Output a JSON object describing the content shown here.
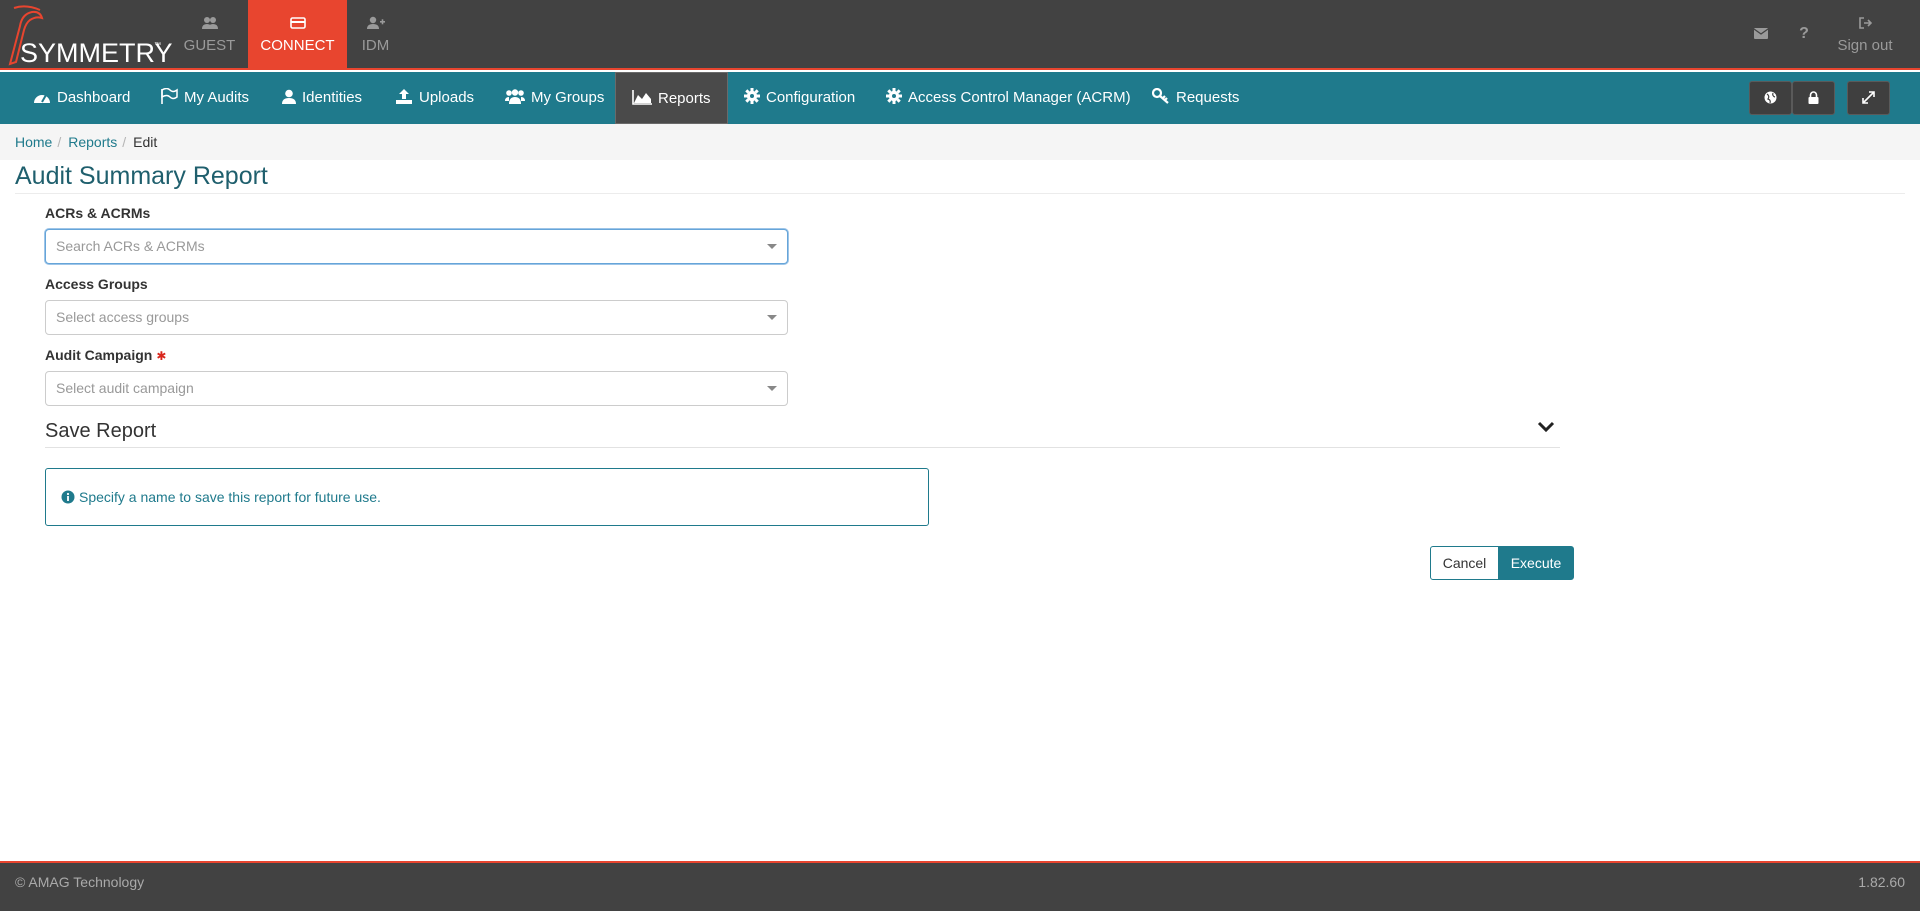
{
  "brand": {
    "logo_text": "SYMMETRY",
    "tm": "™"
  },
  "app_tabs": [
    {
      "label": "GUEST",
      "icon": "users-icon"
    },
    {
      "label": "CONNECT",
      "icon": "card-icon",
      "active": true
    },
    {
      "label": "IDM",
      "icon": "user-plus-icon"
    }
  ],
  "top_right": {
    "mail_icon": "envelope-icon",
    "help_icon": "question-icon",
    "signout_label": "Sign out"
  },
  "nav": {
    "items": [
      {
        "label": "Dashboard",
        "icon": "dashboard-icon"
      },
      {
        "label": "My Audits",
        "icon": "flag-icon"
      },
      {
        "label": "Identities",
        "icon": "user-icon"
      },
      {
        "label": "Uploads",
        "icon": "upload-icon"
      },
      {
        "label": "My Groups",
        "icon": "group-icon"
      },
      {
        "label": "Reports",
        "icon": "area-chart-icon",
        "active": true
      },
      {
        "label": "Configuration",
        "icon": "gear-icon"
      },
      {
        "label": "Access Control Manager (ACRM)",
        "icon": "gear-icon"
      },
      {
        "label": "Requests",
        "icon": "key-icon"
      }
    ],
    "right_buttons": [
      "globe-icon",
      "lock-icon",
      "expand-icon"
    ]
  },
  "breadcrumb": {
    "home": "Home",
    "reports": "Reports",
    "current": "Edit"
  },
  "page": {
    "title": "Audit Summary Report"
  },
  "form": {
    "acrs_label": "ACRs & ACRMs",
    "acrs_placeholder": "Search ACRs & ACRMs",
    "groups_label": "Access Groups",
    "groups_placeholder": "Select access groups",
    "campaign_label": "Audit Campaign",
    "campaign_required": "✱",
    "campaign_placeholder": "Select audit campaign"
  },
  "save_report": {
    "title": "Save Report",
    "info": "Specify a name to save this report for future use."
  },
  "actions": {
    "cancel": "Cancel",
    "execute": "Execute"
  },
  "footer": {
    "copyright": "© AMAG Technology",
    "version": "1.82.60"
  },
  "colors": {
    "accent": "#1f7a8c",
    "brand_red": "#e8452f",
    "dark": "#424242"
  }
}
